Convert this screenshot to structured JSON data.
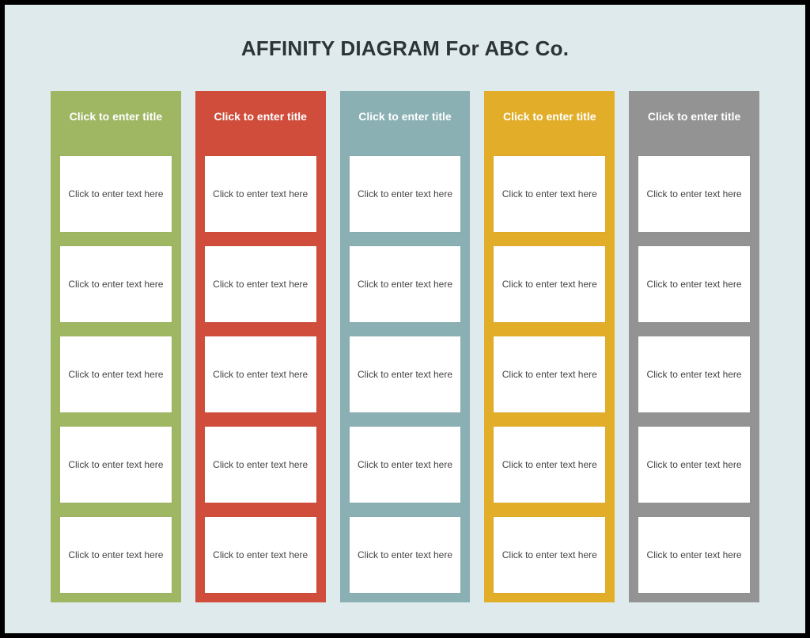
{
  "title": "AFFINITY DIAGRAM For ABC Co.",
  "columns": [
    {
      "color": "#9fb663",
      "title": "Click to enter title",
      "cards": [
        "Click to enter text here",
        "Click to enter text here",
        "Click to enter text here",
        "Click to enter text here",
        "Click to enter text here"
      ]
    },
    {
      "color": "#d04d3b",
      "title": "Click to enter title",
      "cards": [
        "Click to enter text here",
        "Click to enter text here",
        "Click to enter text here",
        "Click to enter text here",
        "Click to enter text here"
      ]
    },
    {
      "color": "#8ab0b4",
      "title": "Click to enter title",
      "cards": [
        "Click to enter text here",
        "Click to enter text here",
        "Click to enter text here",
        "Click to enter text here",
        "Click to enter text here"
      ]
    },
    {
      "color": "#e2ae2a",
      "title": "Click to enter title",
      "cards": [
        "Click to enter text here",
        "Click to enter text here",
        "Click to enter text here",
        "Click to enter text here",
        "Click to enter text here"
      ]
    },
    {
      "color": "#939393",
      "title": "Click to enter title",
      "cards": [
        "Click to enter text here",
        "Click to enter text here",
        "Click to enter text here",
        "Click to enter text here",
        "Click to enter text here"
      ]
    }
  ]
}
